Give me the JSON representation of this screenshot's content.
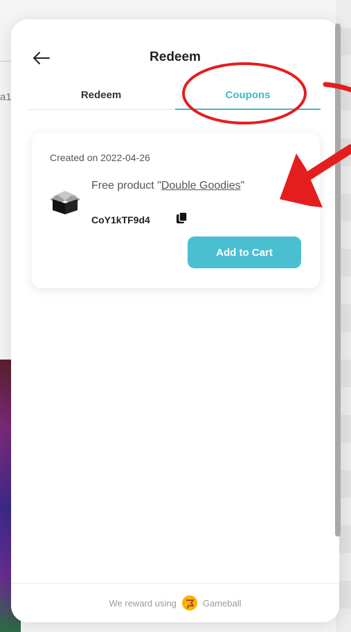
{
  "background": {
    "cut_text": "a1"
  },
  "header": {
    "title": "Redeem"
  },
  "tabs": [
    {
      "label": "Redeem",
      "active": false
    },
    {
      "label": "Coupons",
      "active": true
    }
  ],
  "coupon": {
    "created": "Created on 2022-04-26",
    "product_prefix": "Free product \"",
    "product_link": "Double Goodies",
    "product_suffix": "\"",
    "code": "CoY1kTF9d4",
    "button_label": "Add to Cart"
  },
  "footer": {
    "prefix": "We reward using",
    "brand": "Gameball"
  },
  "colors": {
    "accent": "#3fb8cc",
    "button": "#4bbfd2",
    "annotation": "#e41e1e"
  },
  "icons": [
    "back-arrow-icon",
    "open-box-icon",
    "copy-icon",
    "gameball-logo-icon"
  ]
}
